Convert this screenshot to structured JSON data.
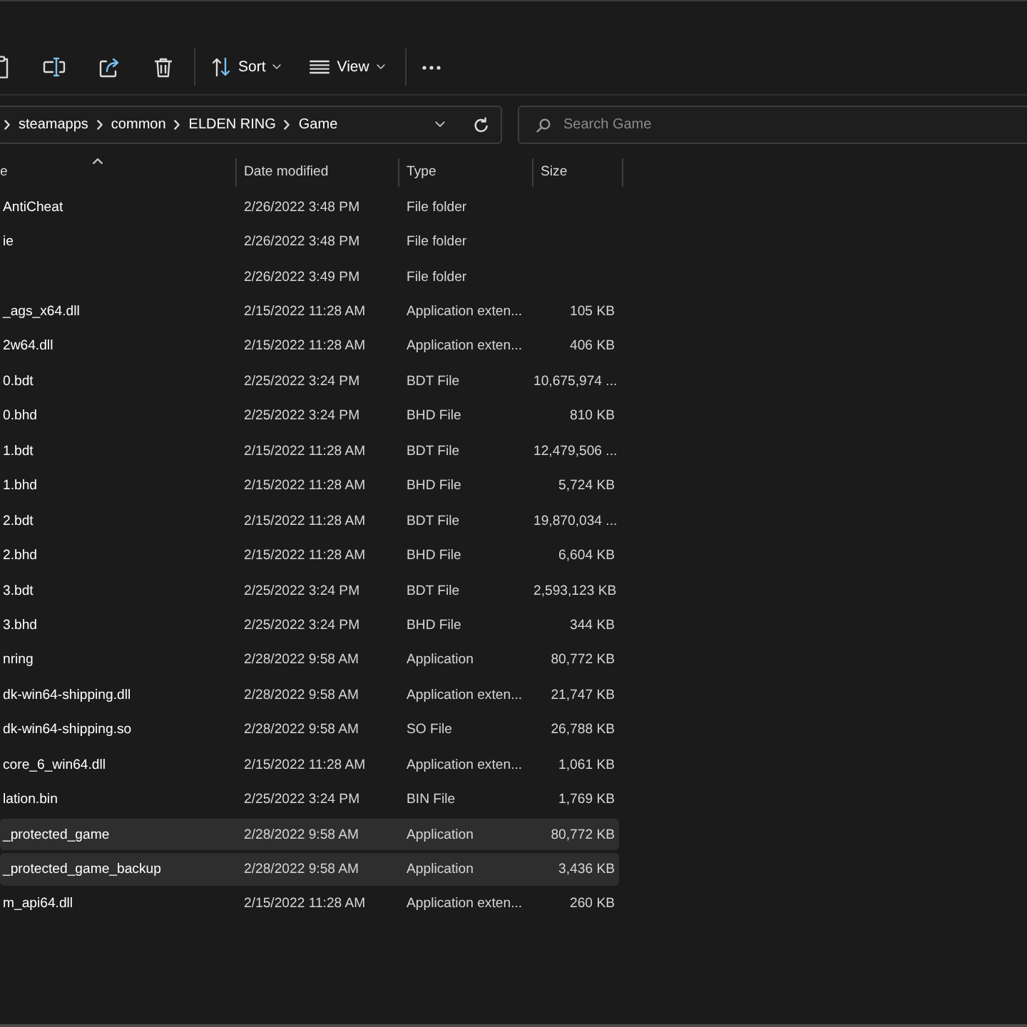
{
  "toolbar": {
    "actions": [
      {
        "label": "Sort"
      },
      {
        "label": "View"
      }
    ]
  },
  "address_bar": {
    "crumbs": [
      "steamapps",
      "common",
      "ELDEN RING",
      "Game"
    ]
  },
  "search": {
    "placeholder": "Search Game"
  },
  "table": {
    "columns": [
      {
        "label": "e",
        "sorted": true
      },
      {
        "label": "Date modified",
        "sorted": false
      },
      {
        "label": "Type",
        "sorted": false
      },
      {
        "label": "Size",
        "sorted": false
      }
    ],
    "rows": [
      {
        "name": "AntiCheat",
        "date_modified": "2/26/2022 3:48 PM",
        "type": "File folder",
        "selected": false
      },
      {
        "name": "ie",
        "date_modified": "2/26/2022 3:48 PM",
        "type": "File folder",
        "selected": false
      },
      {
        "date_modified": "2/26/2022 3:49 PM",
        "type": "File folder",
        "selected": false
      },
      {
        "name": "_ags_x64.dll",
        "date_modified": "2/15/2022 11:28 AM",
        "type": "Application exten...",
        "size": "105 KB",
        "selected": false
      },
      {
        "name": "2w64.dll",
        "date_modified": "2/15/2022 11:28 AM",
        "type": "Application exten...",
        "size": "406 KB",
        "selected": false
      },
      {
        "name": "0.bdt",
        "date_modified": "2/25/2022 3:24 PM",
        "type": "BDT File",
        "size": "10,675,974 ...",
        "selected": false
      },
      {
        "name": "0.bhd",
        "date_modified": "2/25/2022 3:24 PM",
        "type": "BHD File",
        "size": "810 KB",
        "selected": false
      },
      {
        "name": "1.bdt",
        "date_modified": "2/15/2022 11:28 AM",
        "type": "BDT File",
        "size": "12,479,506 ...",
        "selected": false
      },
      {
        "name": "1.bhd",
        "date_modified": "2/15/2022 11:28 AM",
        "type": "BHD File",
        "size": "5,724 KB",
        "selected": false
      },
      {
        "name": "2.bdt",
        "date_modified": "2/15/2022 11:28 AM",
        "type": "BDT File",
        "size": "19,870,034 ...",
        "selected": false
      },
      {
        "name": "2.bhd",
        "date_modified": "2/15/2022 11:28 AM",
        "type": "BHD File",
        "size": "6,604 KB",
        "selected": false
      },
      {
        "name": "3.bdt",
        "date_modified": "2/25/2022 3:24 PM",
        "type": "BDT File",
        "size": "2,593,123 KB",
        "selected": false
      },
      {
        "name": "3.bhd",
        "date_modified": "2/25/2022 3:24 PM",
        "type": "BHD File",
        "size": "344 KB",
        "selected": false
      },
      {
        "name": "nring",
        "date_modified": "2/28/2022 9:58 AM",
        "type": "Application",
        "size": "80,772 KB",
        "selected": false
      },
      {
        "name": "dk-win64-shipping.dll",
        "date_modified": "2/28/2022 9:58 AM",
        "type": "Application exten...",
        "size": "21,747 KB",
        "selected": false
      },
      {
        "name": "dk-win64-shipping.so",
        "date_modified": "2/28/2022 9:58 AM",
        "type": "SO File",
        "size": "26,788 KB",
        "selected": false
      },
      {
        "name": "core_6_win64.dll",
        "date_modified": "2/15/2022 11:28 AM",
        "type": "Application exten...",
        "size": "1,061 KB",
        "selected": false
      },
      {
        "name": "lation.bin",
        "date_modified": "2/25/2022 3:24 PM",
        "type": "BIN File",
        "size": "1,769 KB",
        "selected": false
      },
      {
        "name": "_protected_game",
        "date_modified": "2/28/2022 9:58 AM",
        "type": "Application",
        "size": "80,772 KB",
        "selected": true
      },
      {
        "name": "_protected_game_backup",
        "date_modified": "2/28/2022 9:58 AM",
        "type": "Application",
        "size": "3,436 KB",
        "selected": true
      },
      {
        "name": "m_api64.dll",
        "date_modified": "2/15/2022 11:28 AM",
        "type": "Application exten...",
        "size": "260 KB",
        "selected": false
      }
    ]
  }
}
